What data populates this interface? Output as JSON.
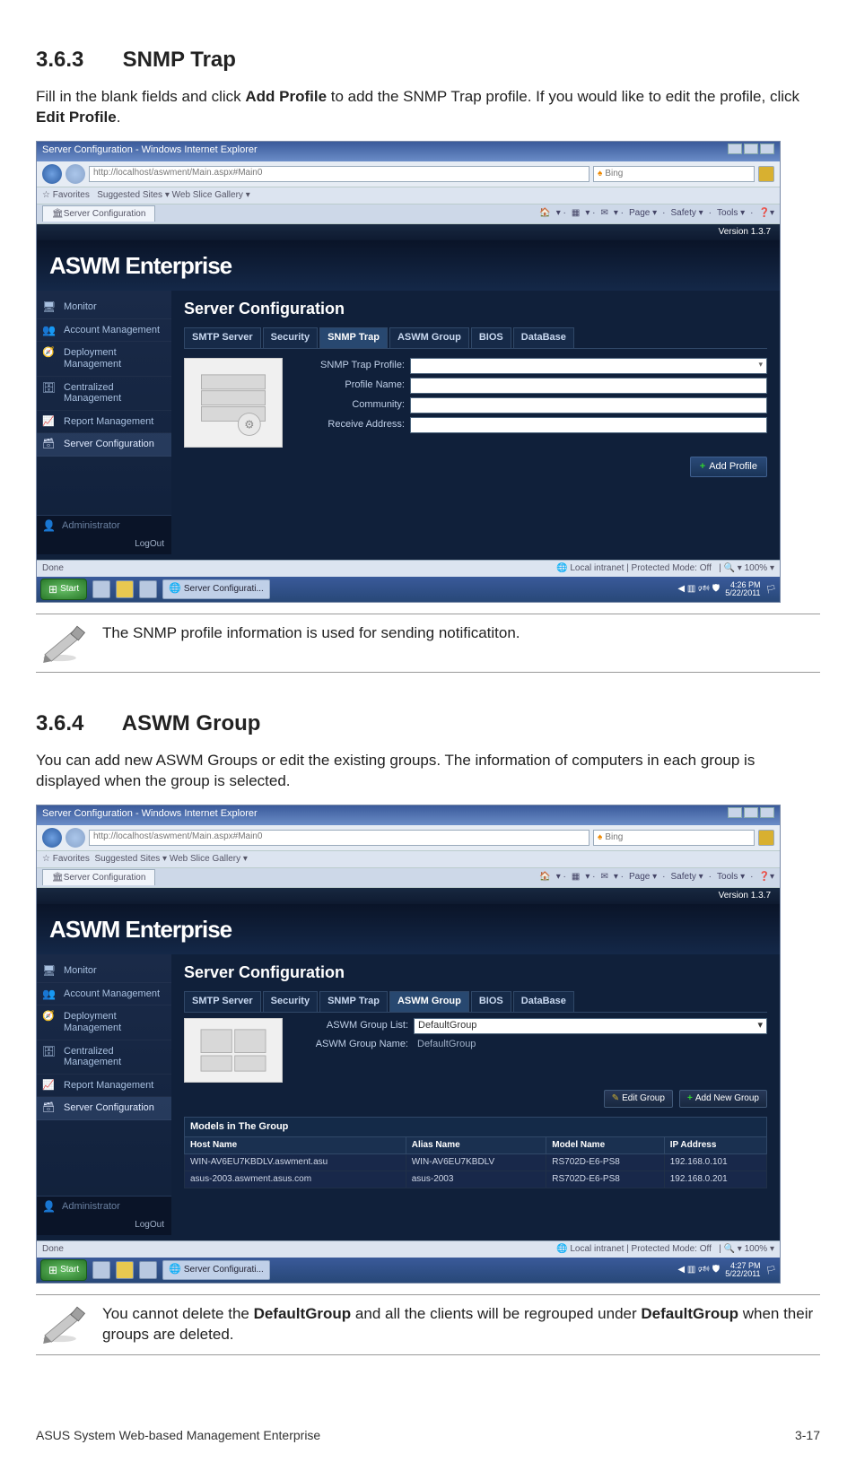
{
  "section_363": {
    "num": "3.6.3",
    "title": "SNMP Trap",
    "intro_a": "Fill in the blank fields and click ",
    "intro_bold1": "Add Profile",
    "intro_b": " to add the SNMP Trap profile. If you would like to edit the profile, click ",
    "intro_bold2": "Edit Profile",
    "intro_c": "."
  },
  "section_364": {
    "num": "3.6.4",
    "title": "ASWM Group",
    "intro": "You can add new ASWM Groups or edit the existing groups. The information of computers in each group is displayed when the group is selected."
  },
  "shared": {
    "window_title": "Server Configuration - Windows Internet Explorer",
    "url_text": "http://localhost/aswment/Main.aspx#Main0",
    "search_provider": "Bing",
    "fav_label": "Favorites",
    "fav_links": "Suggested Sites ▾   Web Slice Gallery ▾",
    "tab_label": "Server Configuration",
    "ie_tools": {
      "home": "🏠",
      "feed": "▦",
      "mail": "✉",
      "page": "Page ▾",
      "safety": "Safety ▾",
      "tools": "Tools ▾",
      "help": "❓▾"
    },
    "version": "Version 1.3.7",
    "logo": "ASWM Enterprise",
    "sidebar": [
      {
        "label": "Monitor",
        "icon": "s-icon-monitor"
      },
      {
        "label": "Account Management",
        "icon": "s-icon-account"
      },
      {
        "label": "Deployment Management",
        "icon": "s-icon-deploy"
      },
      {
        "label": "Centralized Management",
        "icon": "s-icon-central"
      },
      {
        "label": "Report Management",
        "icon": "s-icon-report"
      },
      {
        "label": "Server Configuration",
        "icon": "s-icon-server"
      }
    ],
    "admin_label": "Administrator",
    "logout_label": "LogOut",
    "sc_title": "Server Configuration",
    "p_tabs": [
      "SMTP Server",
      "Security",
      "SNMP Trap",
      "ASWM Group",
      "BIOS",
      "DataBase"
    ],
    "status_done": "Done",
    "status_zone": "Local intranet | Protected Mode: Off",
    "status_zoom": "100%",
    "task_label": "Server Configurati...",
    "start": "Start"
  },
  "shot1": {
    "active_tab_index": 2,
    "form": {
      "profile_sel": "SNMP Trap Profile:",
      "profile_name": "Profile Name:",
      "community": "Community:",
      "receive_addr": "Receive Address:"
    },
    "add_profile_btn": "Add Profile",
    "taskbar_time": "4:26 PM",
    "taskbar_date": "5/22/2011"
  },
  "shot2": {
    "active_tab_index": 3,
    "grp_list_label": "ASWM Group List:",
    "grp_list_value": "DefaultGroup",
    "grp_name_label": "ASWM Group Name:",
    "grp_name_value": "DefaultGroup",
    "edit_btn": "Edit Group",
    "add_btn": "Add New Group",
    "models_title": "Models in The Group",
    "table_headers": [
      "Host Name",
      "Alias Name",
      "Model Name",
      "IP Address"
    ],
    "table_rows": [
      {
        "host": "WIN-AV6EU7KBDLV.aswment.asu",
        "alias": "WIN-AV6EU7KBDLV",
        "model": "RS702D-E6-PS8",
        "ip": "192.168.0.101"
      },
      {
        "host": "asus-2003.aswment.asus.com",
        "alias": "asus-2003",
        "model": "RS702D-E6-PS8",
        "ip": "192.168.0.201"
      }
    ],
    "taskbar_time": "4:27 PM",
    "taskbar_date": "5/22/2011"
  },
  "note1": "The SNMP profile information is used for sending notificatiton.",
  "note2_a": "You cannot delete the ",
  "note2_b1": "DefaultGroup",
  "note2_b": " and all the clients will be regrouped under ",
  "note2_b2": "DefaultGroup",
  "note2_c": " when their groups are deleted.",
  "footer_left": "ASUS System Web-based Management Enterprise",
  "footer_right": "3-17"
}
